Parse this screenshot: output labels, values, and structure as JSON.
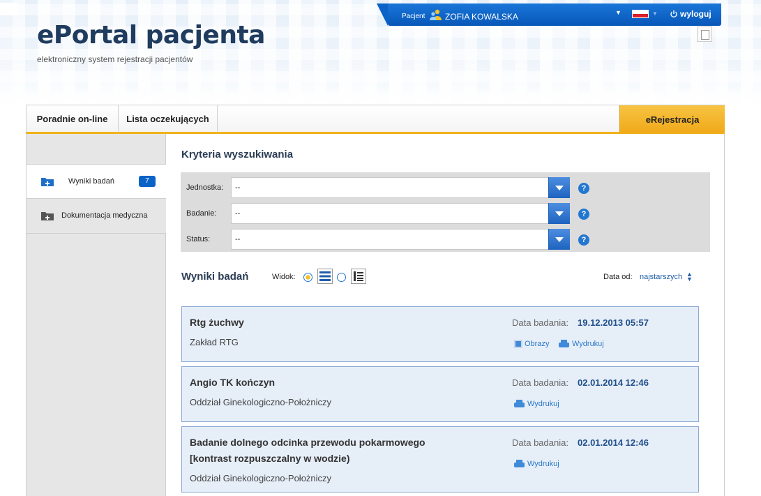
{
  "header": {
    "title": "ePortal pacjenta",
    "subtitle": "elektroniczny system rejestracji pacjentów"
  },
  "topbar": {
    "patient_label": "Pacjent",
    "patient_name": "ZOFIA KOWALSKA",
    "logout_label": "wyloguj",
    "language_flag": "poland-flag-icon"
  },
  "tabs": {
    "items": [
      {
        "label": "Poradnie on-line"
      },
      {
        "label": "Lista oczekujących"
      }
    ],
    "active_label": "eRejestracja"
  },
  "sidebar": {
    "items": [
      {
        "label": "Wyniki badań",
        "badge": "7",
        "icon": "medical-folder-icon"
      },
      {
        "label": "Dokumentacja medyczna",
        "icon": "medical-folder-icon"
      }
    ]
  },
  "criteria": {
    "title": "Kryteria wyszukiwania",
    "fields": [
      {
        "label": "Jednostka:",
        "value": "--"
      },
      {
        "label": "Badanie:",
        "value": "--"
      },
      {
        "label": "Status:",
        "value": "--"
      }
    ],
    "help_glyph": "?"
  },
  "results": {
    "title": "Wyniki badań",
    "view_label": "Widok:",
    "sort_label": "Data od:",
    "sort_value": "najstarszych",
    "date_label": "Data badania:",
    "images_label": "Obrazy",
    "print_label": "Wydrukuj",
    "items": [
      {
        "title_lines": [
          "Rtg żuchwy"
        ],
        "unit": "Zakład RTG",
        "date": "19.12.2013 05:57",
        "has_images": true
      },
      {
        "title_lines": [
          "Angio TK kończyn"
        ],
        "unit": "Oddział Ginekologiczno-Położniczy",
        "date": "02.01.2014 12:46",
        "has_images": false
      },
      {
        "title_lines": [
          "Badanie dolnego odcinka przewodu pokarmowego",
          "[kontrast rozpuszczalny w wodzie)"
        ],
        "unit": "Oddział Ginekologiczno-Położniczy",
        "date": "02.01.2014 12:46",
        "has_images": false
      }
    ]
  },
  "colors": {
    "topbar_blue": "#0b63c8",
    "accent_orange": "#f1b21a",
    "card_bg": "#e6eef8",
    "title_dark": "#1f3b5e"
  }
}
